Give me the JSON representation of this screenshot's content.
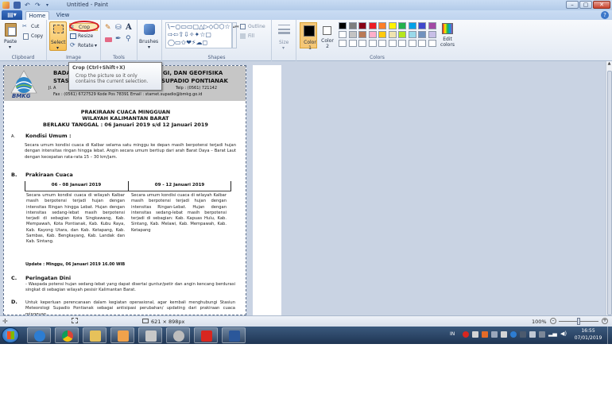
{
  "window": {
    "title": "Untitled - Paint",
    "minimize_icon": "minimize-icon",
    "maximize_icon": "maximize-icon",
    "close_icon": "close-icon"
  },
  "quick_access": [
    "paint-app-icon",
    "save-icon",
    "undo-icon",
    "redo-icon"
  ],
  "ribbon": {
    "file_menu_icon": "file-menu-icon",
    "tabs": [
      {
        "label": "Home",
        "active": true
      },
      {
        "label": "View",
        "active": false
      }
    ],
    "clipboard": {
      "group_label": "Clipboard",
      "paste": "Paste",
      "cut": "Cut",
      "copy": "Copy"
    },
    "image": {
      "group_label": "Image",
      "select": "Select",
      "crop": "Crop",
      "resize": "Resize",
      "rotate": "Rotate"
    },
    "tools": {
      "group_label": "Tools"
    },
    "brushes": {
      "label": "Brushes"
    },
    "shapes": {
      "group_label": "Shapes",
      "outline": "Outline",
      "fill": "Fill",
      "glyphs": "\\~○▭▭▢△▷◇⬠⬡☆ ⇨⇦⇧⇩✧✦☆▢ ◯▭✩❤⚡☁◻"
    },
    "size": {
      "label": "Size"
    },
    "colors": {
      "group_label": "Colors",
      "color1": "Color 1",
      "color2": "Color 2",
      "edit": "Edit colors",
      "color1_value": "#000000",
      "color2_value": "#ffffff",
      "palette": [
        "#000000",
        "#7f7f7f",
        "#880015",
        "#ed1c24",
        "#ff7f27",
        "#fff200",
        "#22b14c",
        "#00a2e8",
        "#3f48cc",
        "#a349a4",
        "#ffffff",
        "#c3c3c3",
        "#b97a57",
        "#ffaec9",
        "#ffc90e",
        "#efe4b0",
        "#b5e61d",
        "#99d9ea",
        "#7092be",
        "#c8bfe7",
        "#ffffff",
        "#ffffff",
        "#ffffff",
        "#ffffff",
        "#ffffff",
        "#ffffff",
        "#ffffff",
        "#ffffff",
        "#ffffff",
        "#ffffff"
      ]
    }
  },
  "tooltip": {
    "title": "Crop (Ctrl+Shift+X)",
    "description": "Crop the picture so it only contains the current selection."
  },
  "document": {
    "logo_text": "BMKG",
    "header_line1_left": "BADA",
    "header_line1_right": "GI, DAN GEOFISIKA",
    "header_line2_left": "STAS",
    "header_line2_right": "SUPADIO PONTIANAK",
    "header_line3_left": "Jl. A",
    "header_line3_right": "Telp : (0561) 721142",
    "header_line4": "Fax : (0561) 6727529    Kode Pos 78391     Email : stamet.supadio@bmkg.go.id",
    "title1": "PRAKIRAAN CUACA MINGGUAN",
    "title2": "WILAYAH KALIMANTAN BARAT",
    "title3": "BERLAKU TANGGAL :  06 Januari 2019 s/d  12 Januari 2019",
    "sec_a_letter": "A.",
    "sec_a_title": "Kondisi Umum :",
    "sec_a_text": "Secara umum kondisi cuaca di Kalbar selama satu minggu ke depan masih berpotensi terjadi hujan dengan intensitas ringan hingga lebat.  Angin secara umum bertiup dari arah Barat Daya – Barat Laut dengan kecepatan rata-rata 15 – 30 km/jam.",
    "sec_b_letter": "B.",
    "sec_b_title": "Prakiraan Cuaca",
    "col1_header": "06 - 08 Januari 2019",
    "col2_header": "09 - 12 Januari 2019",
    "col1_text": "Secara umum kondisi cuaca di wilayah Kalbar masih berpotensi terjadi hujan dengan intensitas Ringan hingga Lebat. Hujan dengan intensitas sedang-lebat masih berpotensi terjadi di sebagian Kota Singkawang, Kab. Mempawah, Kota Pontianak, Kab. Kubu Raya, Kab. Kayong Utara, dan Kab. Ketapang, Kab. Sambas, Kab. Bengkayang, Kab. Landak dan Kab. Sintang.",
    "col2_text": "Secara umum kondisi cuaca di wilayah Kalbar masih berpotensi terjadi hujan dengan intensitas Ringan-Lebat. Hujan dengan intensitas sedang-lebat masih berpotensi terjadi di sebagian: Kab. Kapuas Hulu, Kab. Sintang, Kab. Melawi, Kab. Mempawah, Kab. Ketapang",
    "update": "Update :  Minggu, 06 Januari 2019 16.00 WIB",
    "sec_c_letter": "C.",
    "sec_c_title": "Peringatan Dini",
    "sec_c_text": "- Waspada potensi hujan sedang-lebat  yang dapat disertai guntur/petir dan angin kencang berdurasi singkat di sebagian wilayah pesisir Kalimantan Barat.",
    "sec_d_letter": "D.",
    "sec_d_text": "Untuk keperluan perencanaan dalam kegiatan operasional, agar kembali menghubungi Stasiun Meteorologi Supadio Pontianak sebagai antisipasi perubahan/ updating dari prakiraan cuaca mingguan."
  },
  "status": {
    "dimensions": "621 × 898px",
    "zoom": "100%"
  },
  "taskbar": {
    "apps": [
      "ie-icon",
      "chrome-icon",
      "explorer-icon",
      "outlook-icon",
      "tools-icon",
      "media-icon",
      "acrobat-icon",
      "word-icon"
    ],
    "tray_lang": "IN",
    "time": "16:55",
    "date": "07/01/2019"
  }
}
